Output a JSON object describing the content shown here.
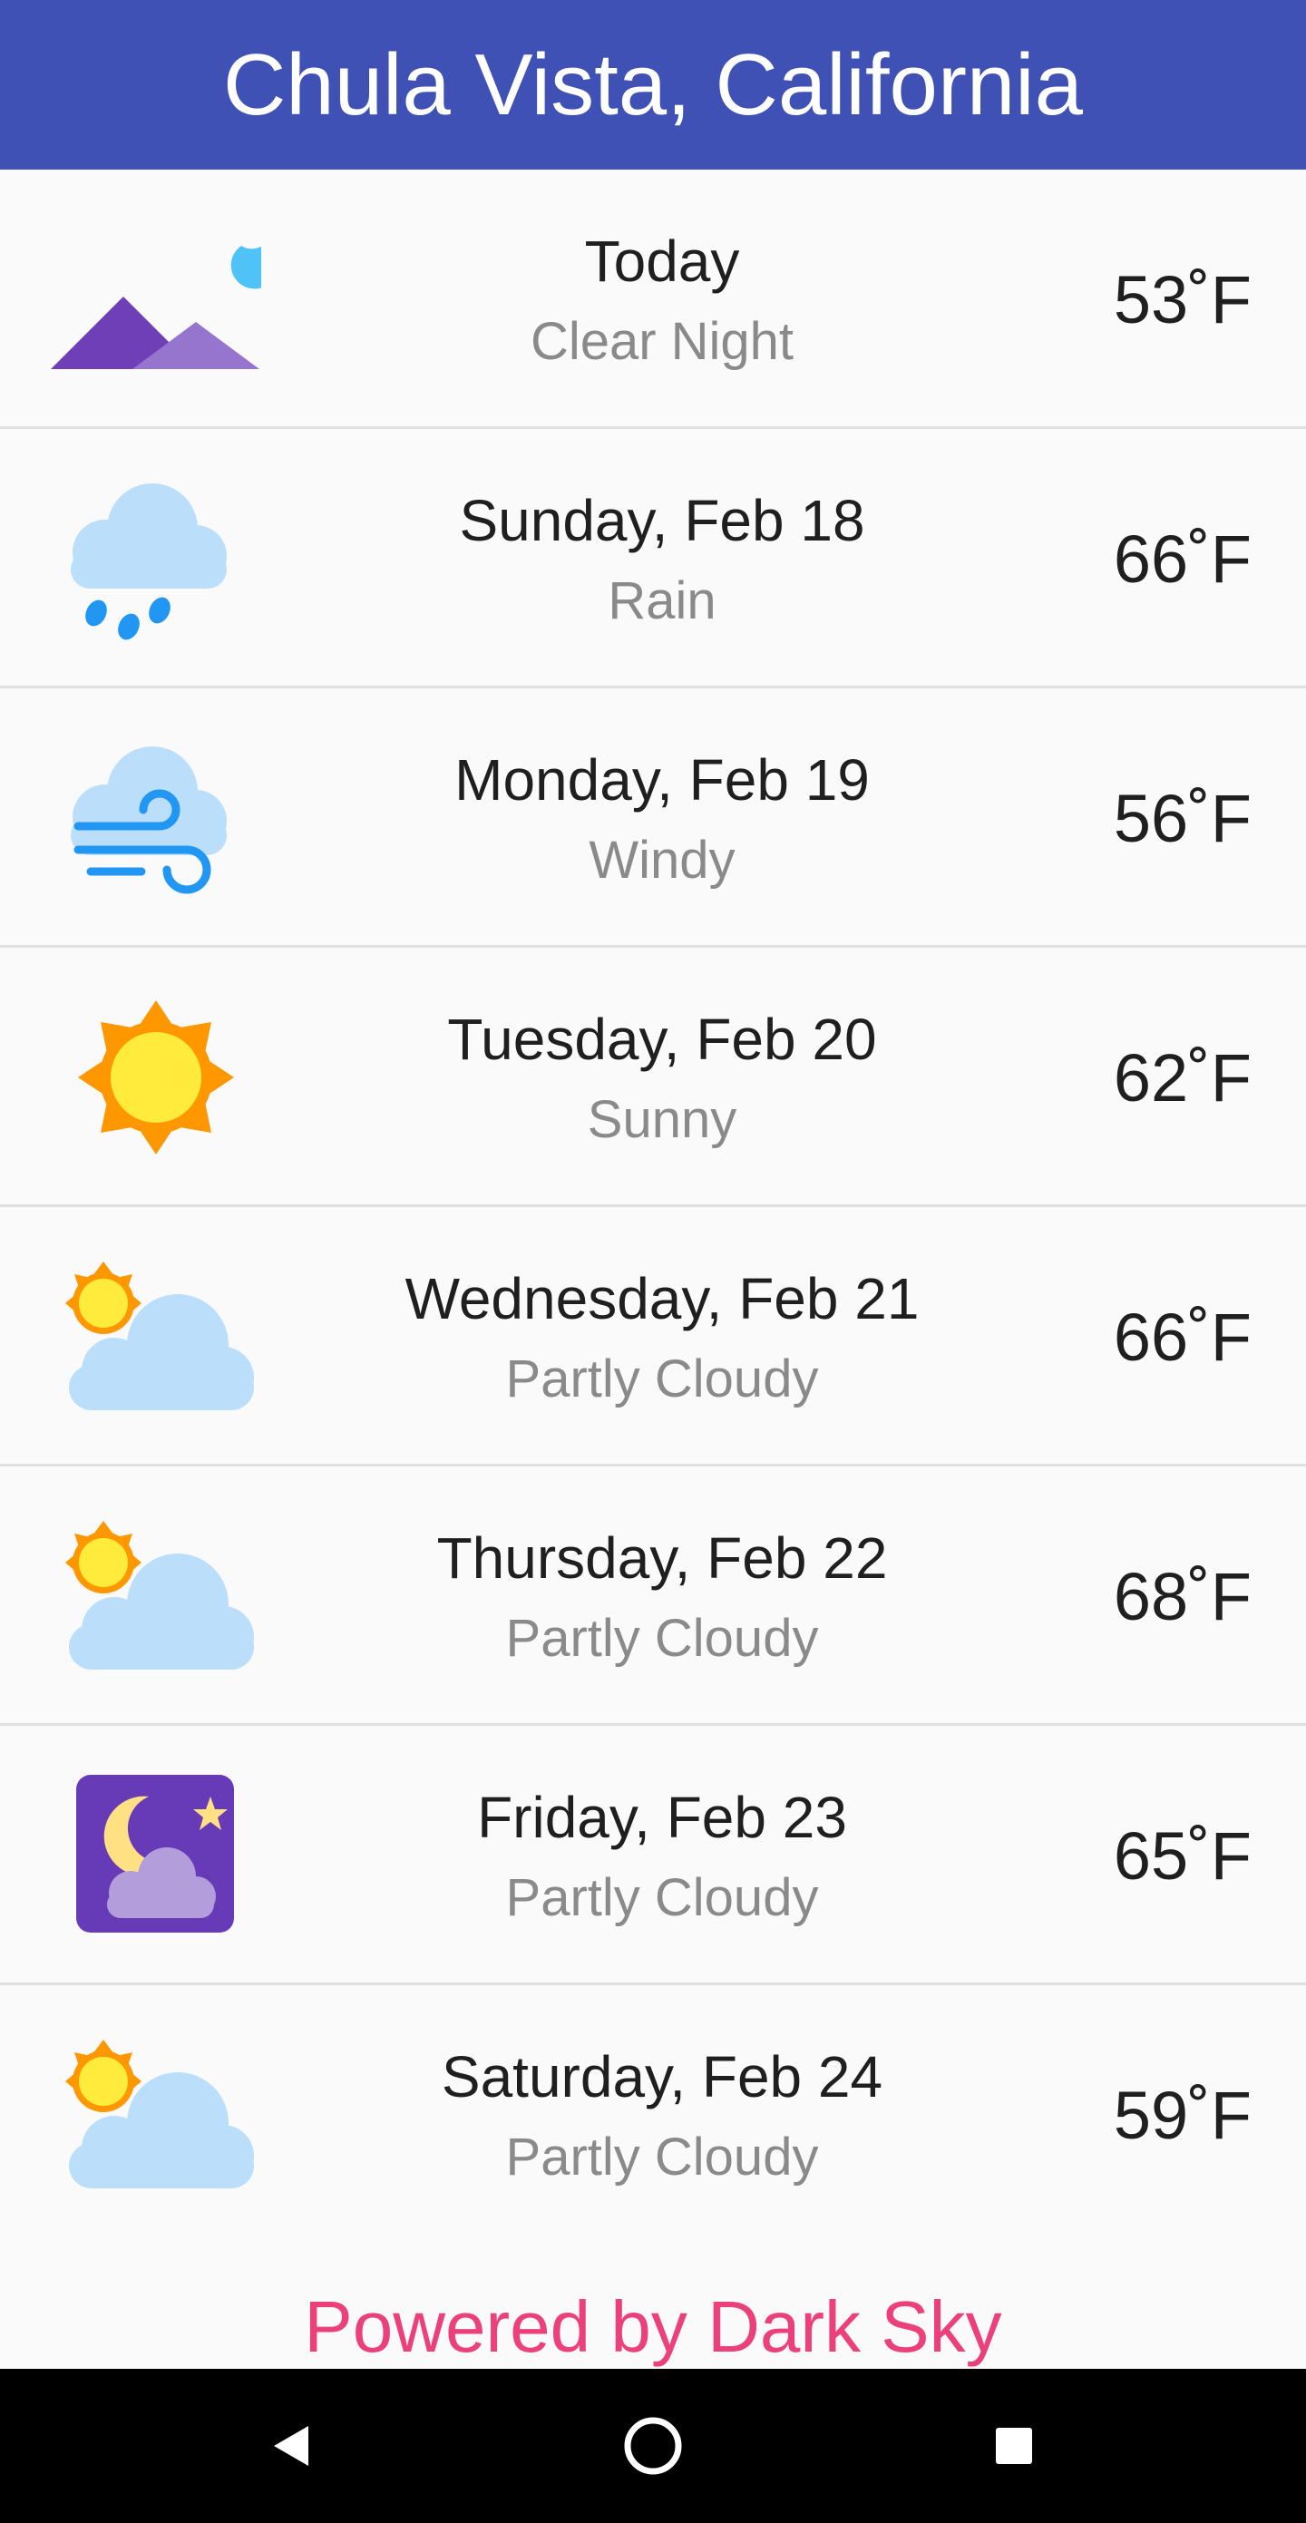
{
  "header": {
    "title": "Chula Vista, California"
  },
  "forecast": [
    {
      "day": "Today",
      "condition": "Clear Night",
      "temperature": "53˚F",
      "icon": "clear-night-icon"
    },
    {
      "day": "Sunday, Feb 18",
      "condition": "Rain",
      "temperature": "66˚F",
      "icon": "rain-icon"
    },
    {
      "day": "Monday, Feb 19",
      "condition": "Windy",
      "temperature": "56˚F",
      "icon": "wind-icon"
    },
    {
      "day": "Tuesday, Feb 20",
      "condition": "Sunny",
      "temperature": "62˚F",
      "icon": "sun-icon"
    },
    {
      "day": "Wednesday, Feb 21",
      "condition": "Partly Cloudy",
      "temperature": "66˚F",
      "icon": "partly-cloudy-day-icon"
    },
    {
      "day": "Thursday, Feb 22",
      "condition": "Partly Cloudy",
      "temperature": "68˚F",
      "icon": "partly-cloudy-day-icon"
    },
    {
      "day": "Friday, Feb 23",
      "condition": "Partly Cloudy",
      "temperature": "65˚F",
      "icon": "partly-cloudy-night-icon"
    },
    {
      "day": "Saturday, Feb 24",
      "condition": "Partly Cloudy",
      "temperature": "59˚F",
      "icon": "partly-cloudy-day-icon"
    }
  ],
  "footer": {
    "attribution": "Powered by Dark Sky"
  },
  "navigation": {
    "back_icon": "back-triangle-icon",
    "home_icon": "home-circle-icon",
    "recents_icon": "recents-square-icon"
  },
  "colors": {
    "header_bg": "#3f51b5",
    "attribution": "#ec407a"
  }
}
